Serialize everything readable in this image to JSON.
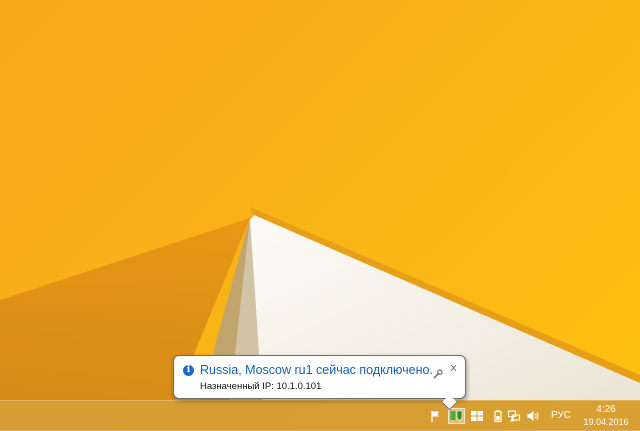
{
  "notification": {
    "title": "Russia, Moscow ru1 сейчас подключено.",
    "text": "Назначенный IP: 10.1.0.101",
    "info_icon": "info-icon",
    "settings_icon": "wrench-icon",
    "close_icon": "close-icon",
    "close_glyph": "x"
  },
  "taskbar": {
    "language": "РУС",
    "time": "4:26",
    "date": "19.04.2016",
    "tray_icons": [
      "action-center-flag-icon",
      "vpn-shield-icon",
      "windows-logo-icon",
      "battery-icon",
      "network-icon",
      "volume-icon"
    ]
  },
  "colors": {
    "accent_title": "#1a5fb4",
    "vpn_green": "#3cb43c",
    "taskbar": "#cd963c"
  }
}
